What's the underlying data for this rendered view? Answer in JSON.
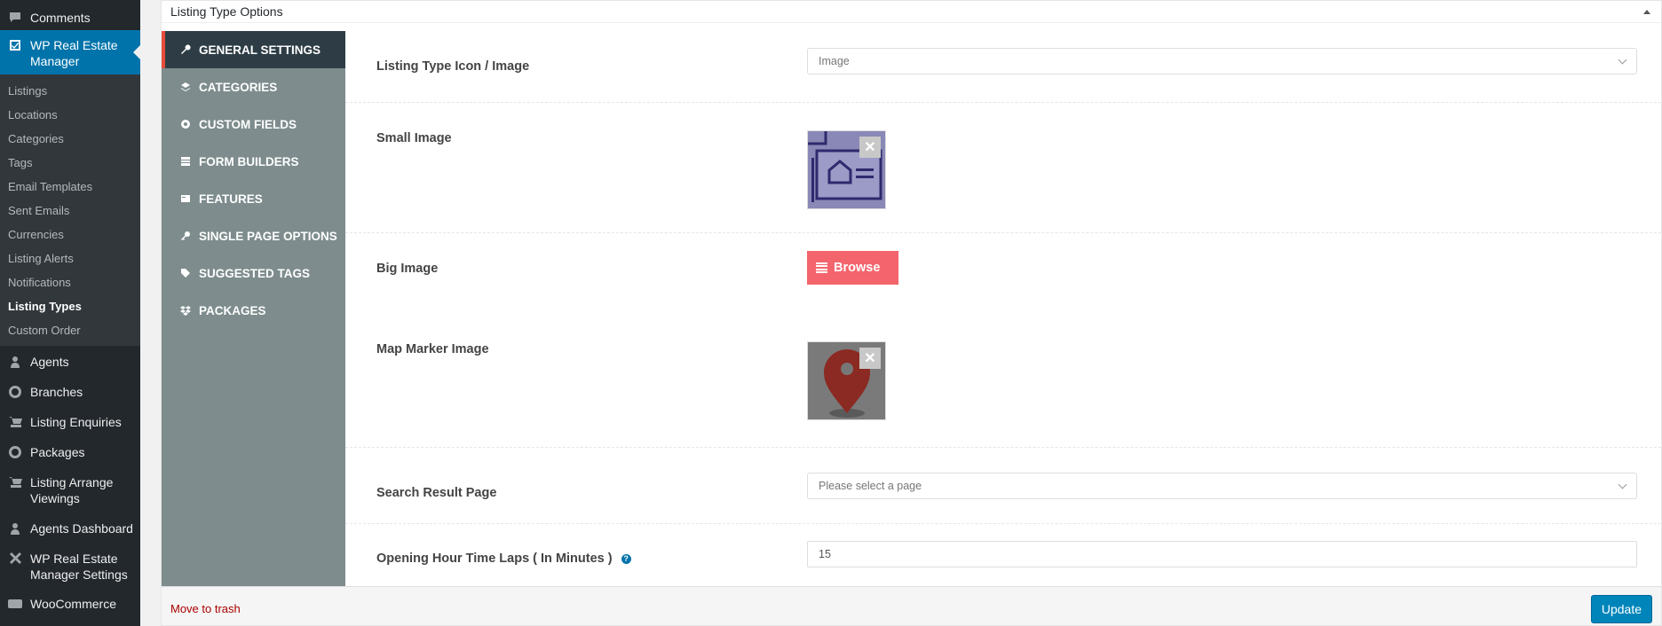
{
  "sidebar": {
    "comments_label": "Comments",
    "current_menu_label": "WP Real Estate Manager",
    "submenu": [
      {
        "label": "Listings"
      },
      {
        "label": "Locations"
      },
      {
        "label": "Categories"
      },
      {
        "label": "Tags"
      },
      {
        "label": "Email Templates"
      },
      {
        "label": "Sent Emails"
      },
      {
        "label": "Currencies"
      },
      {
        "label": "Listing Alerts"
      },
      {
        "label": "Notifications"
      },
      {
        "label": "Listing Types"
      },
      {
        "label": "Custom Order"
      }
    ],
    "menu": [
      {
        "label": "Agents",
        "icon": "agent-icon"
      },
      {
        "label": "Branches",
        "icon": "branch-icon"
      },
      {
        "label": "Listing Enquiries",
        "icon": "cart-icon"
      },
      {
        "label": "Packages",
        "icon": "package-icon"
      },
      {
        "label": "Listing Arrange Viewings",
        "icon": "cart-icon"
      },
      {
        "label": "Agents Dashboard",
        "icon": "dashboard-icon"
      },
      {
        "label": "WP Real Estate Manager Settings",
        "icon": "tools-icon"
      },
      {
        "label": "WooCommerce",
        "icon": "woo-icon"
      }
    ]
  },
  "metabox": {
    "title": "Listing Type Options",
    "tabs": [
      {
        "label": "GENERAL SETTINGS",
        "icon": "wrench-icon"
      },
      {
        "label": "CATEGORIES",
        "icon": "layers-icon"
      },
      {
        "label": "CUSTOM FIELDS",
        "icon": "settings-icon"
      },
      {
        "label": "FORM BUILDERS",
        "icon": "form-icon"
      },
      {
        "label": "FEATURES",
        "icon": "card-icon"
      },
      {
        "label": "SINGLE PAGE OPTIONS",
        "icon": "key-icon"
      },
      {
        "label": "SUGGESTED TAGS",
        "icon": "tags-icon"
      },
      {
        "label": "PACKAGES",
        "icon": "dropbox-icon"
      }
    ],
    "fields": {
      "icon_image_label": "Listing Type Icon / Image",
      "icon_image_value": "Image",
      "small_image_label": "Small Image",
      "big_image_label": "Big Image",
      "browse_label": "Browse",
      "map_marker_label": "Map Marker Image",
      "search_result_label": "Search Result Page",
      "search_result_placeholder": "Please select a page",
      "opening_hour_label": "Opening Hour Time Laps ( In Minutes )",
      "opening_hour_value": "15"
    },
    "remove_glyph": "✕",
    "help_glyph": "?"
  },
  "footer": {
    "trash_label": "Move to trash",
    "update_label": "Update"
  },
  "colors": {
    "admin_bar": "#23282d",
    "accent": "#0073aa",
    "tab_bg": "#7e8c8d",
    "tab_active": "#2e3d45",
    "browse": "#f4646c"
  }
}
